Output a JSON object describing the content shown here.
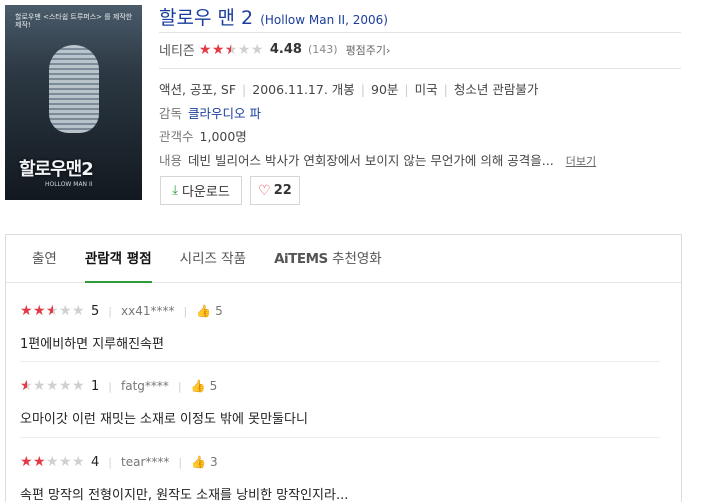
{
  "poster": {
    "tagline": "할로우맨 <스타쉽 트루퍼스> 를 제작한 제작!",
    "title": "할로우맨2",
    "subtitle": "HOLLOW MAN II"
  },
  "movie": {
    "title": "할로우 맨 2",
    "original_title": "(Hollow Man II, 2006)",
    "rating_label": "네티즌",
    "rating_stars": 2.5,
    "score": "4.48",
    "rating_count": "(143)",
    "rate_link": "평점주기›",
    "genre": "액션, 공포, SF",
    "release": "2006.11.17. 개봉",
    "runtime": "90분",
    "country": "미국",
    "age_rating": "청소년 관람불가",
    "director_label": "감독",
    "director": "클라우디오 파",
    "audience_label": "관객수",
    "audience": "1,000명",
    "synopsis_label": "내용",
    "synopsis": "데빈 빌리어스 박사가 연회장에서 보이지 않는 무언가에 의해 공격을...",
    "more_link": "더보기"
  },
  "buttons": {
    "download": "다운로드",
    "like_count": "22"
  },
  "tabs": [
    {
      "label": "출연"
    },
    {
      "label": "관람객 평점"
    },
    {
      "label": "시리즈 작품"
    },
    {
      "label_brand": "AiTEMS",
      "label": "추천영화"
    }
  ],
  "reviews": [
    {
      "stars": 2.5,
      "score": "5",
      "user": "xx41****",
      "likes": "5",
      "text": "1편에비하면 지루해진속편"
    },
    {
      "stars": 0.5,
      "score": "1",
      "user": "fatg****",
      "likes": "5",
      "text": "오마이갓 이런 재밋는 소재로 이정도 밖에 못만둘다니"
    },
    {
      "stars": 2,
      "score": "4",
      "user": "tear****",
      "likes": "3",
      "text": "속편 망작의 전형이지만, 원작도 소재를 낭비한 망작인지라..."
    }
  ],
  "colors": {
    "accent_red": "#e33a45",
    "link_blue": "#1a3e9c",
    "accent_green": "#2f9b3a"
  }
}
